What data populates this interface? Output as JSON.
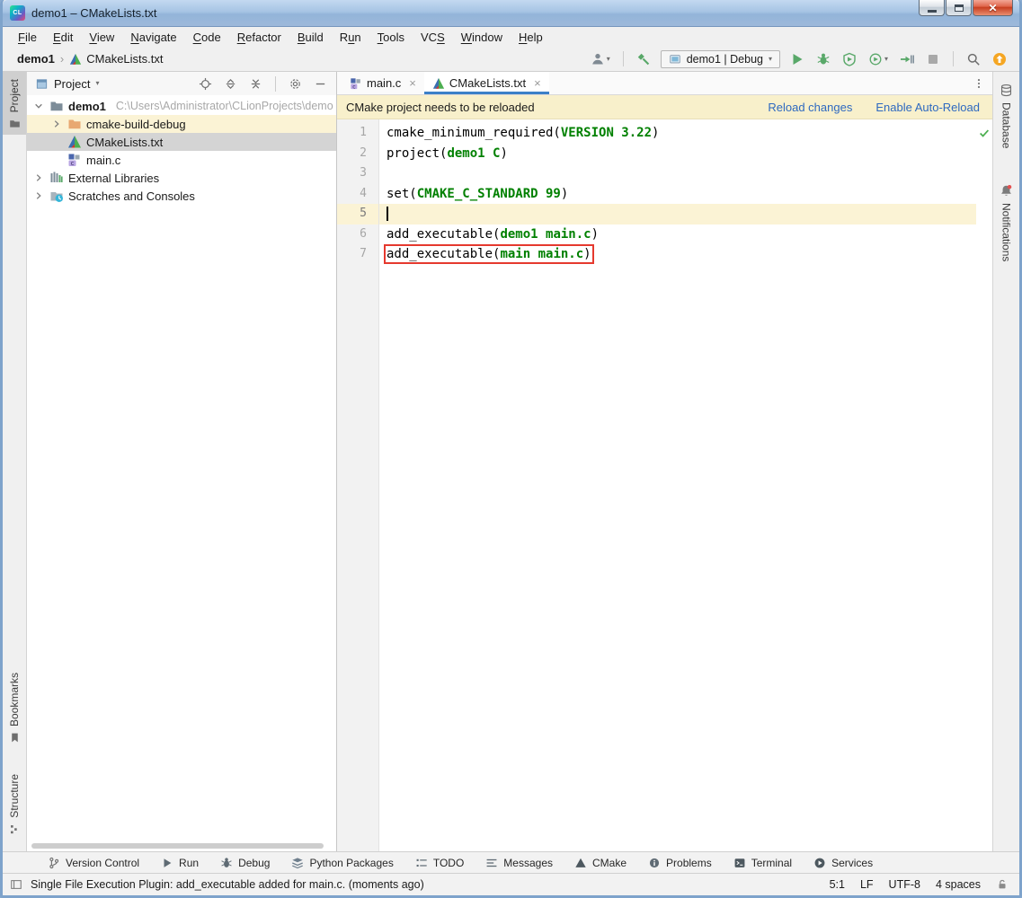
{
  "window": {
    "title": "demo1 – CMakeLists.txt",
    "controls": [
      {
        "name": "minimize"
      },
      {
        "name": "maximize"
      },
      {
        "name": "close"
      }
    ]
  },
  "menu": {
    "items": [
      {
        "label": "File",
        "u": 0
      },
      {
        "label": "Edit",
        "u": 0
      },
      {
        "label": "View",
        "u": 0
      },
      {
        "label": "Navigate",
        "u": 0
      },
      {
        "label": "Code",
        "u": 0
      },
      {
        "label": "Refactor",
        "u": 0
      },
      {
        "label": "Build",
        "u": 0
      },
      {
        "label": "Run",
        "u": 1
      },
      {
        "label": "Tools",
        "u": 0
      },
      {
        "label": "VCS",
        "u": 2
      },
      {
        "label": "Window",
        "u": 0
      },
      {
        "label": "Help",
        "u": 0
      }
    ]
  },
  "toolbar": {
    "breadcrumb": [
      {
        "label": "demo1",
        "bold": true
      },
      {
        "label": "CMakeLists.txt",
        "icon": "cmake"
      }
    ],
    "run_config": "demo1 | Debug",
    "left_icons": [
      {
        "icon": "user",
        "name": "user-profile",
        "dropdown": true
      },
      {
        "sep": true
      },
      {
        "icon": "hammer",
        "name": "build"
      }
    ],
    "right_icons": [
      {
        "icon": "play",
        "name": "run"
      },
      {
        "icon": "bug",
        "name": "debug"
      },
      {
        "icon": "coverage",
        "name": "run-with-coverage"
      },
      {
        "icon": "profiler",
        "name": "profiler",
        "dropdown": true
      },
      {
        "icon": "attach",
        "name": "attach-to-process"
      },
      {
        "icon": "stop",
        "name": "stop"
      },
      {
        "sep": true
      },
      {
        "icon": "search",
        "name": "search-everywhere"
      },
      {
        "icon": "update",
        "name": "update"
      }
    ]
  },
  "left_strip": {
    "top": [
      {
        "label": "Project",
        "icon": "folderTool",
        "active": true
      }
    ],
    "bottom": [
      {
        "label": "Bookmarks",
        "icon": "bookmark"
      },
      {
        "label": "Structure",
        "icon": "structure"
      }
    ]
  },
  "project_panel": {
    "header": "Project",
    "header_icons": [
      {
        "icon": "locate",
        "name": "select-opened-file"
      },
      {
        "icon": "expandAll",
        "name": "expand-all"
      },
      {
        "icon": "collapseAll",
        "name": "collapse-all"
      },
      {
        "sep": true
      },
      {
        "icon": "gear",
        "name": "settings"
      },
      {
        "icon": "minus",
        "name": "hide-panel"
      }
    ],
    "tree": [
      {
        "label": "demo1",
        "path": "C:\\Users\\Administrator\\CLionProjects\\demo",
        "icon": "folder-gray",
        "bold": true,
        "chevron": "down",
        "indent": 0
      },
      {
        "label": "cmake-build-debug",
        "icon": "folder-orange",
        "chevron": "right",
        "indent": 1,
        "highlight": true
      },
      {
        "label": "CMakeLists.txt",
        "icon": "cmake",
        "indent": 1,
        "selected": true
      },
      {
        "label": "main.c",
        "icon": "cfile",
        "indent": 1
      },
      {
        "label": "External Libraries",
        "icon": "libs",
        "chevron": "right",
        "indent": 0
      },
      {
        "label": "Scratches and Consoles",
        "icon": "scratch",
        "chevron": "right",
        "indent": 0
      }
    ]
  },
  "editor": {
    "tabs": [
      {
        "label": "main.c",
        "icon": "cfile",
        "active": false
      },
      {
        "label": "CMakeLists.txt",
        "icon": "cmake",
        "active": true
      }
    ],
    "notification": {
      "text": "CMake project needs to be reloaded",
      "actions": [
        "Reload changes",
        "Enable Auto-Reload"
      ]
    },
    "lines": [
      {
        "n": 1,
        "segs": [
          {
            "t": "cmake_minimum_required(",
            "s": "p"
          },
          {
            "t": "VERSION 3.22",
            "s": "g"
          },
          {
            "t": ")",
            "s": "p"
          }
        ]
      },
      {
        "n": 2,
        "segs": [
          {
            "t": "project(",
            "s": "p"
          },
          {
            "t": "demo1 C",
            "s": "g"
          },
          {
            "t": ")",
            "s": "p"
          }
        ]
      },
      {
        "n": 3,
        "segs": []
      },
      {
        "n": 4,
        "segs": [
          {
            "t": "set(",
            "s": "p"
          },
          {
            "t": "CMAKE_C_STANDARD 99",
            "s": "g"
          },
          {
            "t": ")",
            "s": "p"
          }
        ]
      },
      {
        "n": 5,
        "segs": [],
        "current": true,
        "cursor": true
      },
      {
        "n": 6,
        "segs": [
          {
            "t": "add_executable(",
            "s": "p"
          },
          {
            "t": "demo1 main.c",
            "s": "g"
          },
          {
            "t": ")",
            "s": "p"
          }
        ]
      },
      {
        "n": 7,
        "segs": [
          {
            "t": "add_executable(",
            "s": "p"
          },
          {
            "t": "main main.c",
            "s": "g"
          },
          {
            "t": ")",
            "s": "p"
          }
        ],
        "annotated": true
      }
    ]
  },
  "right_strip": {
    "items": [
      {
        "label": "Database",
        "icon": "database"
      },
      {
        "label": "Notifications",
        "icon": "bell",
        "badge": true
      }
    ]
  },
  "bottom_bar": {
    "items": [
      {
        "label": "Version Control",
        "icon": "branch"
      },
      {
        "label": "Run",
        "icon": "play-gray"
      },
      {
        "label": "Debug",
        "icon": "bug-gray"
      },
      {
        "label": "Python Packages",
        "icon": "packages"
      },
      {
        "label": "TODO",
        "icon": "todo"
      },
      {
        "label": "Messages",
        "icon": "messages"
      },
      {
        "label": "CMake",
        "icon": "cmake-mono"
      },
      {
        "label": "Problems",
        "icon": "problems"
      },
      {
        "label": "Terminal",
        "icon": "terminal"
      },
      {
        "label": "Services",
        "icon": "services"
      }
    ]
  },
  "status_bar": {
    "message": "Single File Execution Plugin: add_executable added for main.c. (moments ago)",
    "segments": [
      "5:1",
      "LF",
      "UTF-8",
      "4 spaces"
    ]
  },
  "colors": {
    "notification_bg": "#f8f0cb",
    "link": "#2e69c0",
    "code_green": "#008000",
    "annotation_red": "#e5392e",
    "active_tab_underline": "#3c80c8",
    "selection_gray": "#d4d4d4",
    "current_line": "#fbf3d5"
  }
}
